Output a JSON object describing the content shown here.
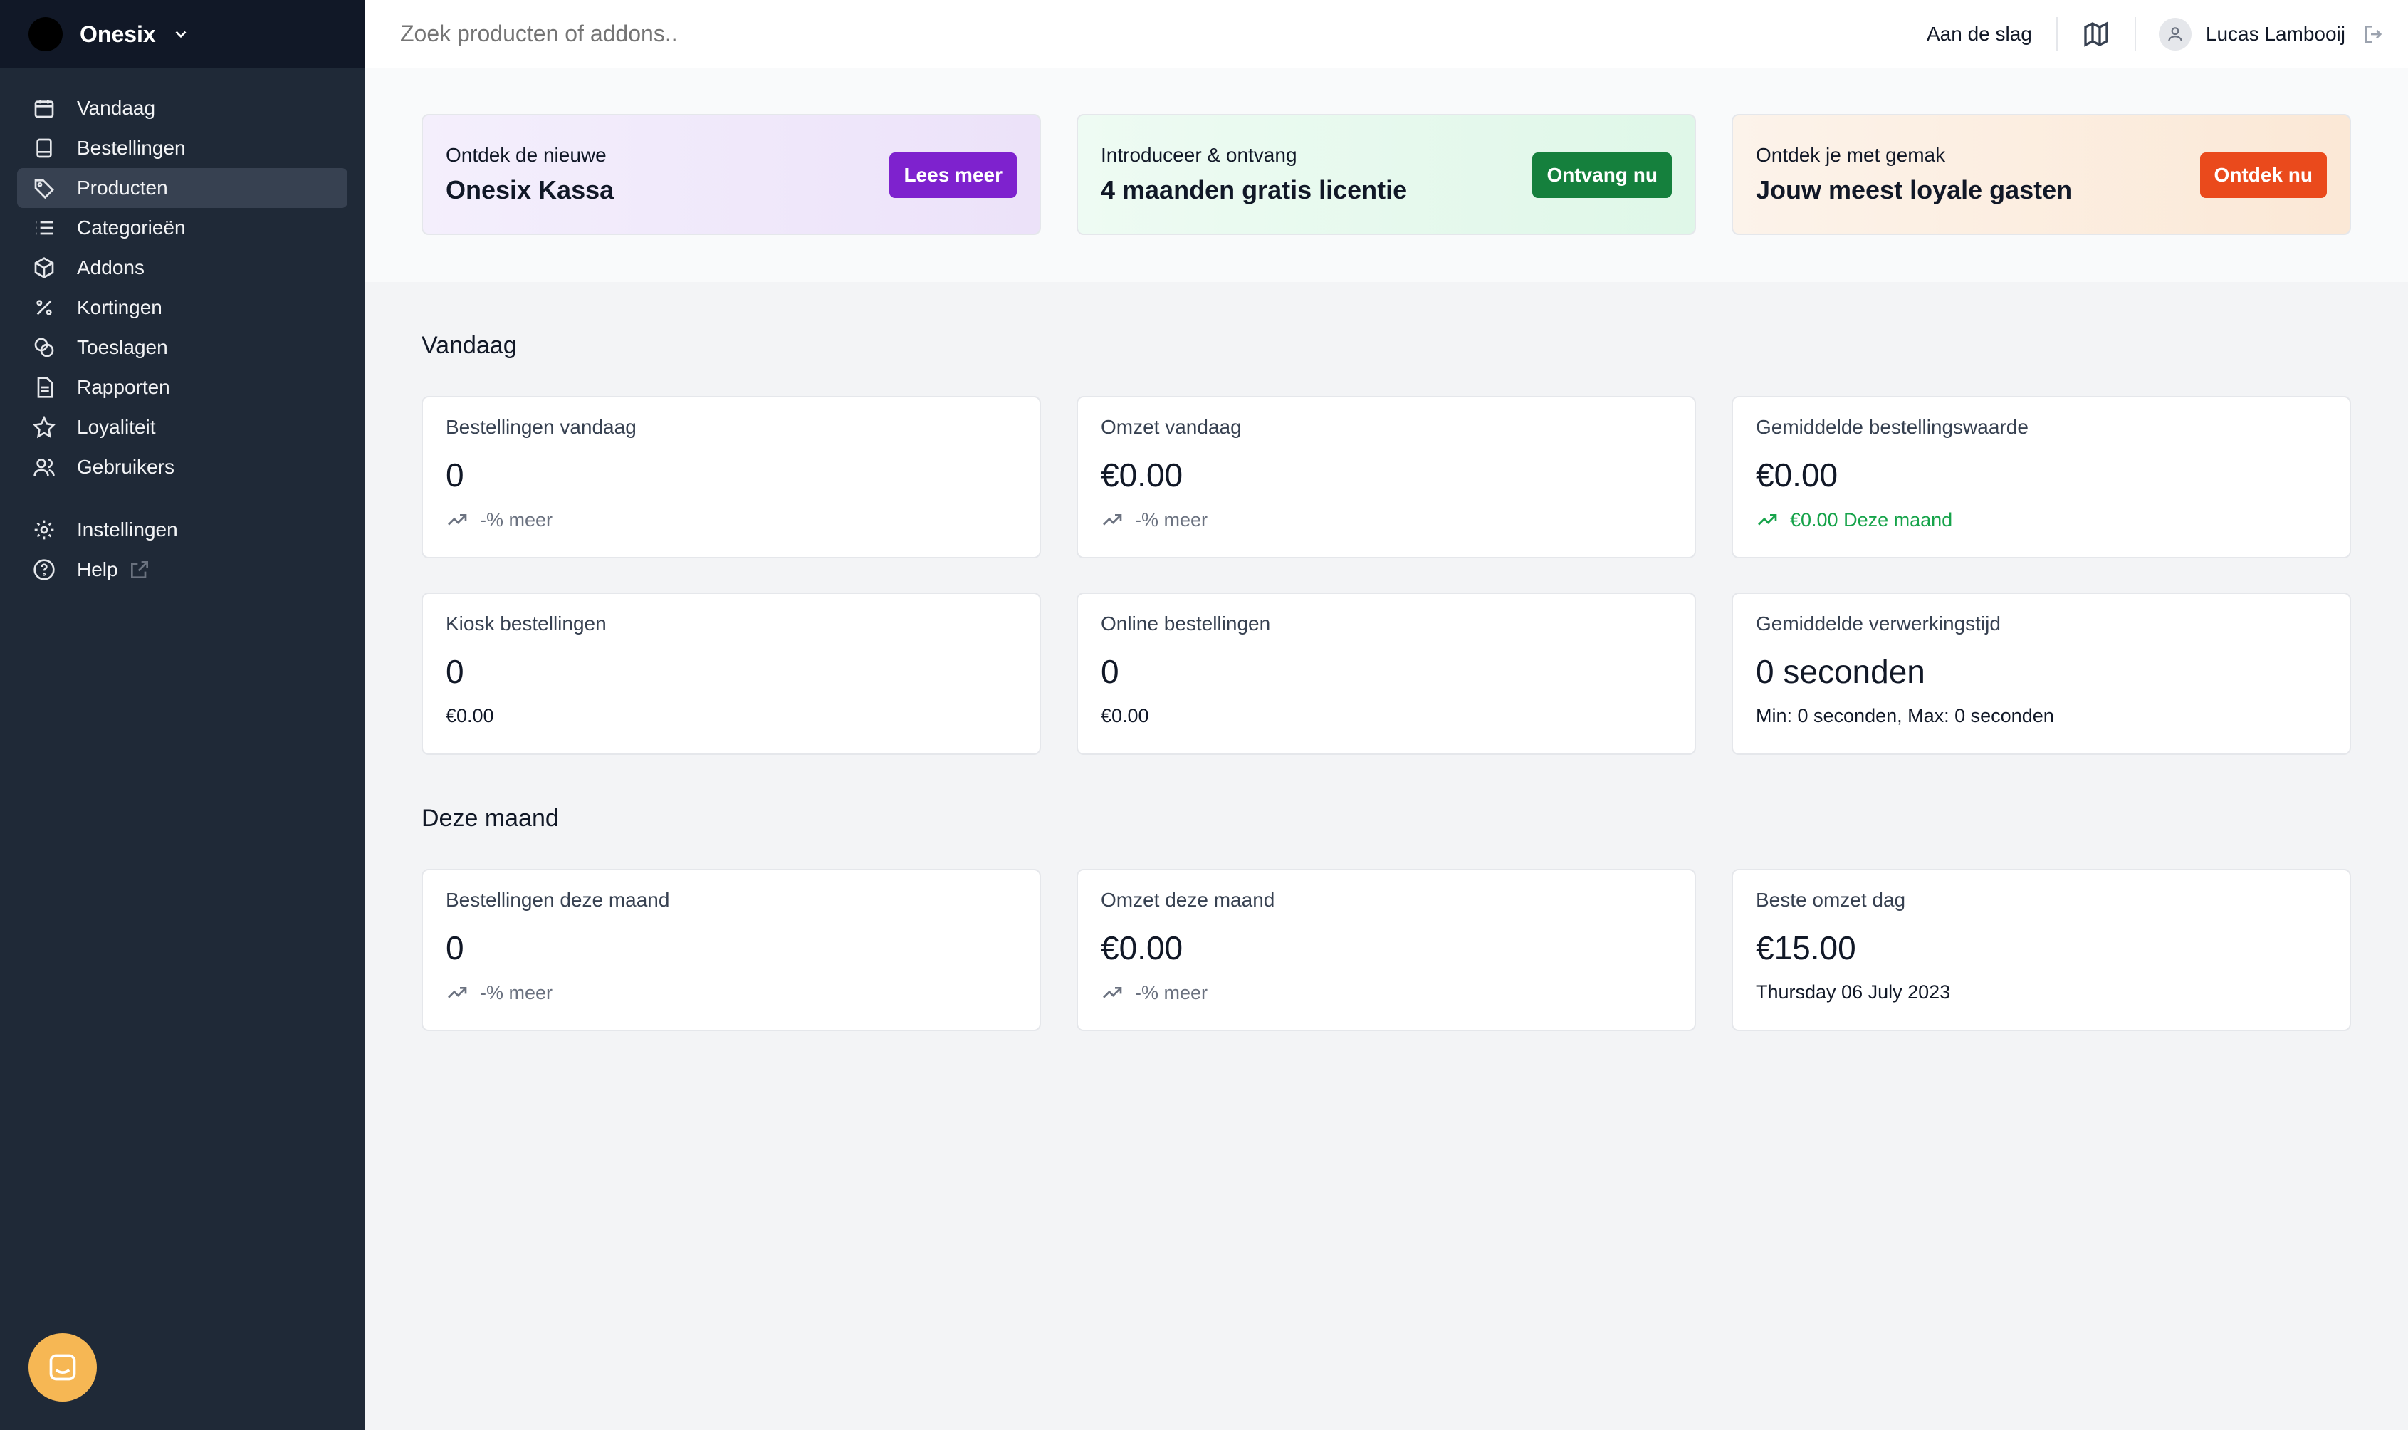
{
  "sidebar": {
    "brand": "Onesix",
    "items": [
      {
        "label": "Vandaag",
        "icon": "calendar-icon"
      },
      {
        "label": "Bestellingen",
        "icon": "receipt-icon"
      },
      {
        "label": "Producten",
        "icon": "tag-icon",
        "active": true
      },
      {
        "label": "Categorieën",
        "icon": "list-icon"
      },
      {
        "label": "Addons",
        "icon": "cube-icon"
      },
      {
        "label": "Kortingen",
        "icon": "percent-icon"
      },
      {
        "label": "Toeslagen",
        "icon": "coins-icon"
      },
      {
        "label": "Rapporten",
        "icon": "document-icon"
      },
      {
        "label": "Loyaliteit",
        "icon": "star-icon"
      },
      {
        "label": "Gebruikers",
        "icon": "users-icon"
      }
    ],
    "bottom_items": [
      {
        "label": "Instellingen",
        "icon": "gear-icon"
      },
      {
        "label": "Help",
        "icon": "help-icon"
      }
    ]
  },
  "topbar": {
    "search_placeholder": "Zoek producten of addons..",
    "getting_started": "Aan de slag",
    "user_name": "Lucas Lambooij"
  },
  "promos": [
    {
      "small": "Ontdek de nieuwe",
      "big": "Onesix Kassa",
      "button": "Lees meer",
      "color": "#7e22ce"
    },
    {
      "small": "Introduceer & ontvang",
      "big": "4 maanden gratis licentie",
      "button": "Ontvang nu",
      "color": "#15803d"
    },
    {
      "small": "Ontdek je met gemak",
      "big": "Jouw meest loyale gasten",
      "button": "Ontdek nu",
      "color": "#ea4a1c"
    }
  ],
  "today": {
    "title": "Vandaag",
    "cards": [
      {
        "label": "Bestellingen vandaag",
        "value": "0",
        "sub": "-% meer"
      },
      {
        "label": "Omzet vandaag",
        "value": "€0.00",
        "sub": "-% meer"
      },
      {
        "label": "Gemiddelde bestellingswaarde",
        "value": "€0.00",
        "sub": "€0.00 Deze maand"
      },
      {
        "label": "Kiosk bestellingen",
        "value": "0",
        "sub": "€0.00"
      },
      {
        "label": "Online bestellingen",
        "value": "0",
        "sub": "€0.00"
      },
      {
        "label": "Gemiddelde verwerkingstijd",
        "value": "0 seconden",
        "sub": "Min: 0 seconden, Max: 0 seconden"
      }
    ]
  },
  "month": {
    "title": "Deze maand",
    "cards": [
      {
        "label": "Bestellingen deze maand",
        "value": "0",
        "sub": "-% meer"
      },
      {
        "label": "Omzet deze maand",
        "value": "€0.00",
        "sub": "-% meer"
      },
      {
        "label": "Beste omzet dag",
        "value": "€15.00",
        "sub": "Thursday 06 July 2023"
      }
    ]
  },
  "colors": {
    "sidebar": "#1f2937",
    "positive": "#16a34a"
  }
}
